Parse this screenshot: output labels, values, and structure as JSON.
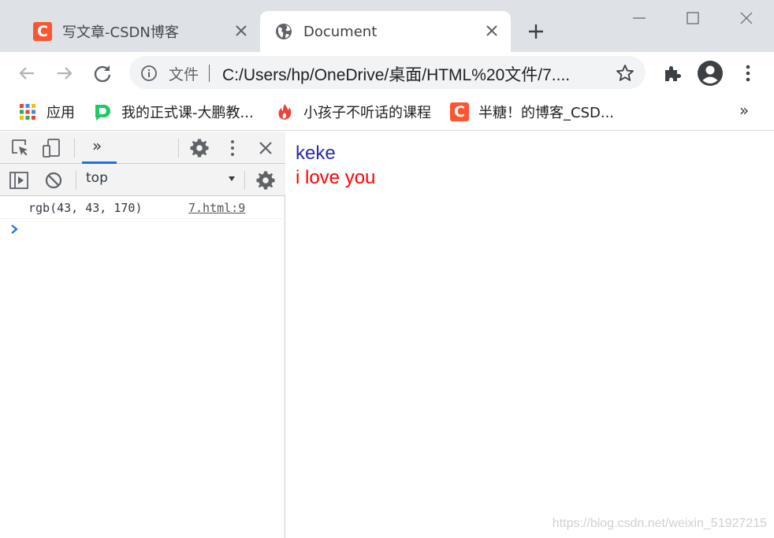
{
  "tabs": [
    {
      "title": "写文章-CSDN博客",
      "favicon": "csdn-logo",
      "logo_letter": "C",
      "active": false
    },
    {
      "title": "Document",
      "favicon": "globe-icon",
      "active": true
    }
  ],
  "toolbar": {
    "site_info_label": "文件",
    "url": "C:/Users/hp/OneDrive/桌面/HTML%20文件/7...."
  },
  "bookmarks": {
    "items": [
      {
        "label": "应用",
        "icon": "apps-grid-icon"
      },
      {
        "label": "我的正式课-大鹏教...",
        "icon": "dapeng-icon"
      },
      {
        "label": "小孩子不听话的课程",
        "icon": "flame-icon"
      },
      {
        "label": "半糖！的博客_CSD...",
        "icon": "csdn-logo",
        "logo_letter": "C"
      }
    ],
    "more": "»"
  },
  "devtools": {
    "tab_label": "»",
    "context": "top",
    "console": [
      {
        "text": "rgb(43, 43, 170)",
        "source": "7.html:9"
      }
    ],
    "prompt": "›"
  },
  "page": {
    "line1": "keke",
    "line2": "i love you",
    "watermark": "https://blog.csdn.net/weixin_51927215"
  },
  "colors": {
    "tabstrip_bg": "#dee1e6",
    "csdn_brand": "#fc5531",
    "line1_color": "#2b2baa",
    "line2_color": "#ff0000",
    "devtools_accent": "#1a73e8"
  }
}
